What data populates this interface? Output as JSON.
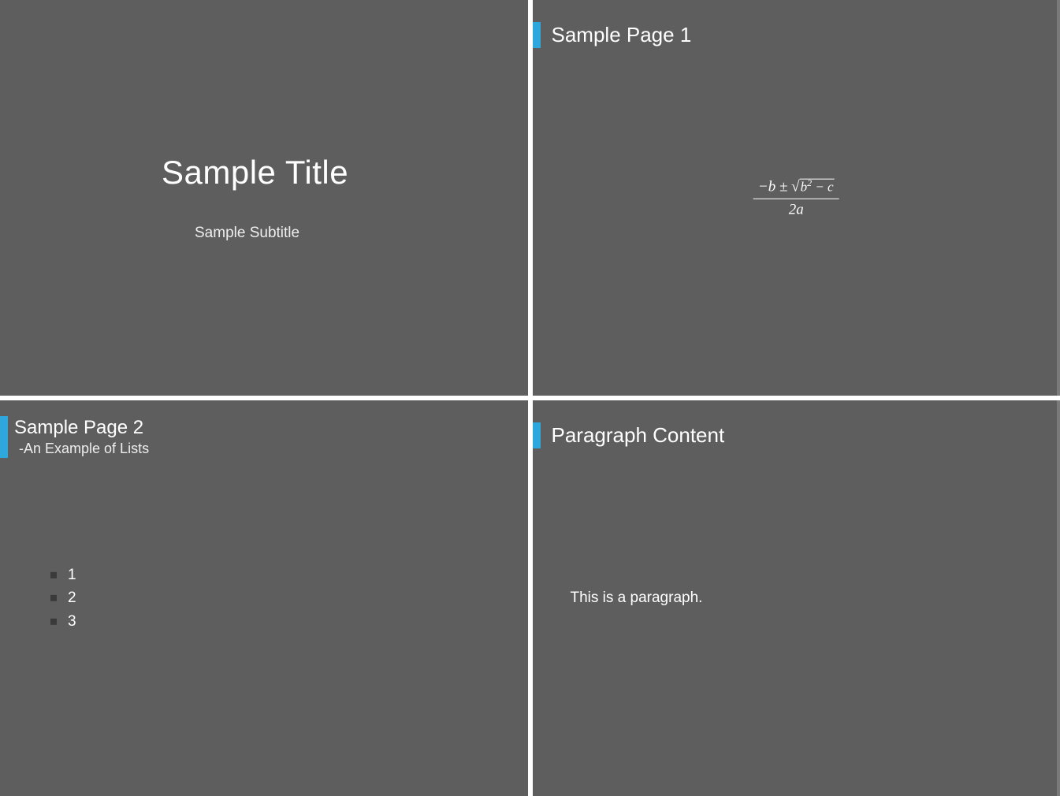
{
  "slide1": {
    "title": "Sample Title",
    "subtitle": "Sample Subtitle"
  },
  "slide2": {
    "title": "Sample Page 1",
    "formula": {
      "numerator_prefix": "−b ±",
      "radicand": "b",
      "radicand_exp": "2",
      "radicand_suffix": " − c",
      "denominator": "2a"
    }
  },
  "slide3": {
    "title": "Sample Page 2",
    "subtitle": "-An Example of Lists",
    "items": [
      "1",
      "2",
      "3"
    ]
  },
  "slide4": {
    "title": "Paragraph Content",
    "paragraph": "This is a paragraph."
  }
}
